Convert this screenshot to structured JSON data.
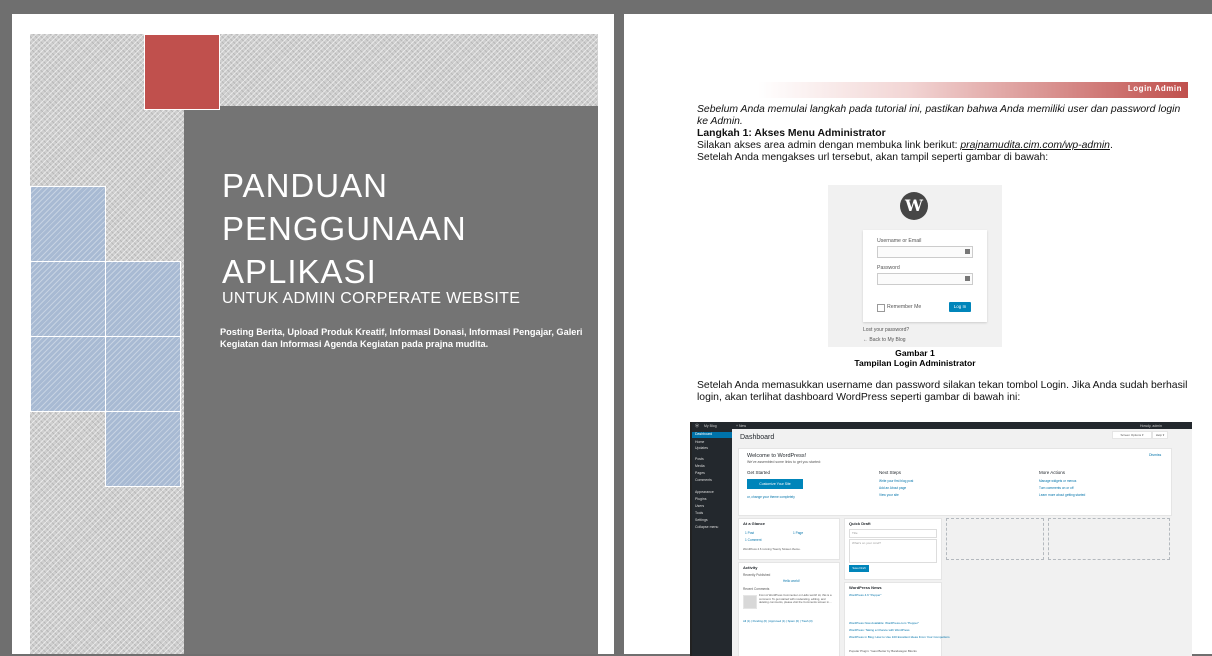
{
  "cover": {
    "title_lines": [
      "PANDUAN",
      "PENGGUNAAN",
      "APLIKASI"
    ],
    "subtitle": "UNTUK ADMIN CORPERATE WEBSITE",
    "description": "Posting Berita, Upload Produk Kreatif, Informasi Donasi, Informasi Pengajar, Galeri Kegiatan dan Informasi Agenda Kegiatan pada prajna mudita.",
    "colors": {
      "panel": "#747474",
      "accent": "#c0504d",
      "squares": "#a8bad3"
    }
  },
  "page2": {
    "header_label": "Login Admin",
    "intro": "Sebelum Anda memulai langkah pada tutorial ini, pastikan bahwa Anda memiliki user dan password login ke Admin.",
    "step_heading": "Langkah 1: Akses Menu Administrator",
    "step_text_before_link": "Silakan akses area admin dengan membuka link berikut: ",
    "step_link": "prajnamudita.cim.com/wp-admin",
    "step_text_after_link": ".",
    "step_text2": "Setelah Anda mengakses url tersebut, akan tampil seperti gambar di bawah:",
    "figure1": {
      "logo": "W",
      "username_label": "Username or Email",
      "password_label": "Password",
      "remember_label": "Remember Me",
      "login_button": "Log In",
      "lost_password": "Lost your password?",
      "back_link": "← Back to My Blog",
      "caption_number": "Gambar 1",
      "caption_title": "Tampilan Login Administrator"
    },
    "paragraph2": "Setelah Anda memasukkan username dan password silakan tekan tombol Login. Jika Anda sudah berhasil login, akan terlihat dashboard WordPress seperti gambar di bawah ini:",
    "figure2": {
      "adminbar_site": "My Blog",
      "adminbar_new": "+ New",
      "adminbar_user": "Howdy, admin",
      "menu_items": [
        "Dashboard",
        "Home",
        "Updates",
        "Posts",
        "Media",
        "Pages",
        "Comments",
        "Appearance",
        "Plugins",
        "Users",
        "Tools",
        "Settings",
        "Collapse menu"
      ],
      "page_title": "Dashboard",
      "screen_options": "Screen Options ▾",
      "help": "Help ▾",
      "welcome_title": "Welcome to WordPress!",
      "welcome_sub": "We've assembled some links to get you started:",
      "dismiss": "Dismiss",
      "get_started": "Get Started",
      "customize_button": "Customize Your Site",
      "change_theme": "or, change your theme completely",
      "next_steps": "Next Steps",
      "next_steps_items": [
        "Write your first blog post",
        "Add an About page",
        "View your site"
      ],
      "more_actions": "More Actions",
      "more_actions_items": [
        "Manage widgets or menus",
        "Turn comments on or off",
        "Learn more about getting started"
      ],
      "glance_title": "At a Glance",
      "glance_items": [
        "1 Post",
        "1 Page",
        "1 Comment"
      ],
      "glance_footer": "WordPress 4.6 running Twenty Sixteen theme.",
      "activity_title": "Activity",
      "recently_published": "Recently Published",
      "recent_post": "Hello world!",
      "recent_comments": "Recent Comments",
      "comment_text": "From A WordPress Commenter on Hello world! Hi, this is a comment. To get started with moderating, editing, and deleting comments, please visit the Comments screen in…",
      "comment_counts": "All (1) | Pending (0) | Approved (1) | Spam (0) | Trash (0)",
      "quick_draft_title": "Quick Draft",
      "draft_title_placeholder": "Title",
      "draft_body_placeholder": "What's on your mind?",
      "save_draft": "Save Draft",
      "news_title": "WordPress News",
      "news_items": [
        "WordPress 4.6 \"Pepper\"",
        "WordPress Now Available: WordPress.com \"Pepper\"",
        "WordPress: Taking a Chance with WordPress",
        "WordPress in Blog: How to Use 100 Excellent Ideas From Your Competitors",
        "Popular Plugin: Yoast Better by Bandwagon Blocks"
      ]
    }
  }
}
